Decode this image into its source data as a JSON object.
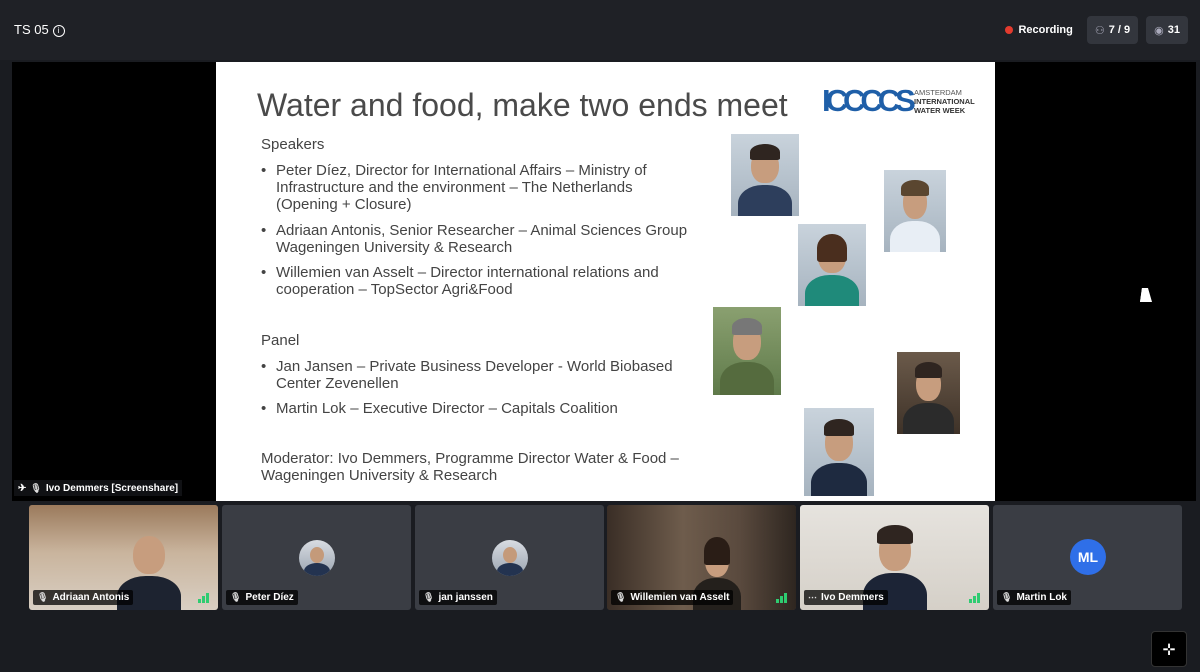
{
  "topbar": {
    "room_title": "TS 05",
    "recording_label": "Recording",
    "participants": "7 / 9",
    "viewers": "31"
  },
  "screenshare_label": "Ivo Demmers [Screenshare]",
  "slide": {
    "title": "Water and food, make two ends meet",
    "logo_lines": [
      "AMSTERDAM",
      "INTERNATIONAL",
      "WATER WEEK"
    ],
    "speakers_heading": "Speakers",
    "speakers": [
      "Peter Díez, Director for International Affairs – Ministry of Infrastructure and the environment – The Netherlands (Opening + Closure)",
      "Adriaan Antonis, Senior Researcher – Animal Sciences Group Wageningen University & Research",
      "Willemien van Asselt – Director international relations and cooperation – TopSector Agri&Food"
    ],
    "panel_heading": "Panel",
    "panel": [
      "Jan Jansen – Private Business Developer - World Biobased Center Zevenellen",
      "Martin Lok – Executive Director – Capitals Coalition"
    ],
    "moderator": "Moderator: Ivo Demmers, Programme Director Water & Food – Wageningen University & Research"
  },
  "participants": [
    {
      "name": "Adriaan Antonis",
      "type": "video"
    },
    {
      "name": "Peter Díez",
      "type": "avatar"
    },
    {
      "name": "jan janssen",
      "type": "avatar"
    },
    {
      "name": "Willemien van Asselt",
      "type": "video"
    },
    {
      "name": "Ivo Demmers",
      "type": "video"
    },
    {
      "name": "Martin Lok",
      "type": "initials",
      "initials": "ML"
    }
  ],
  "colors": {
    "recording_dot": "#e33b2e",
    "initials_avatar": "#2f6fe8",
    "signal": "#2ecc71"
  }
}
